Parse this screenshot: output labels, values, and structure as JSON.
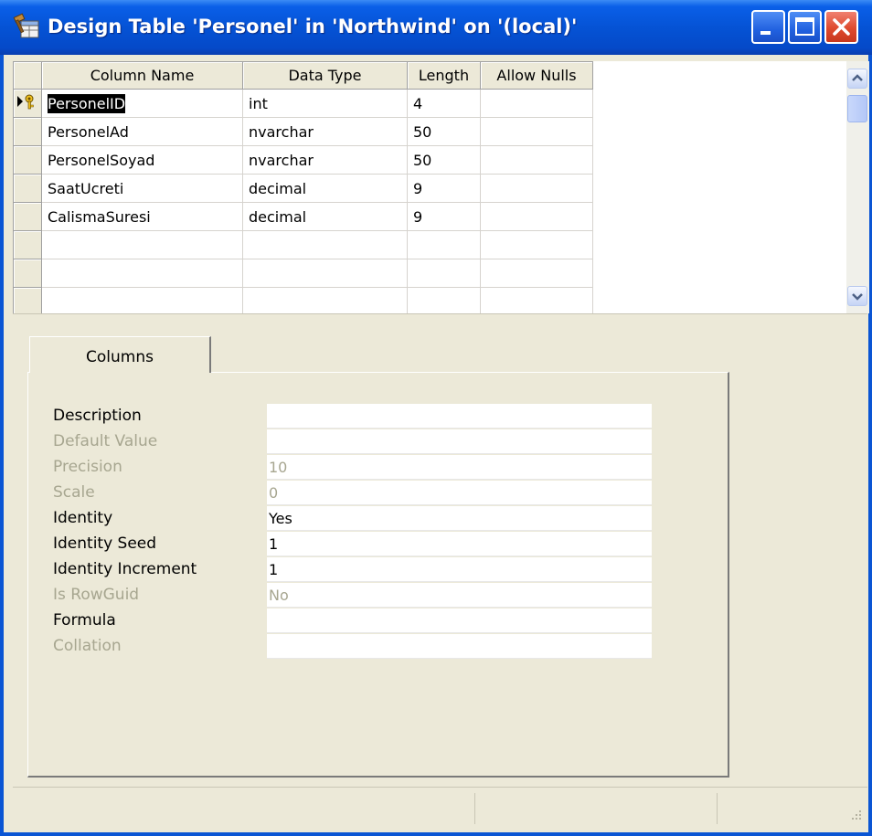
{
  "window": {
    "title": "Design Table 'Personel' in 'Northwind' on '(local)'",
    "buttons": [
      "minimize-icon",
      "maximize-icon",
      "close-icon"
    ]
  },
  "grid": {
    "headers": [
      "Column Name",
      "Data Type",
      "Length",
      "Allow Nulls"
    ],
    "rows": [
      {
        "name": "PersonelID",
        "type": "int",
        "length": "4",
        "nulls": "",
        "primary_key": true,
        "selected": true
      },
      {
        "name": "PersonelAd",
        "type": "nvarchar",
        "length": "50",
        "nulls": ""
      },
      {
        "name": "PersonelSoyad",
        "type": "nvarchar",
        "length": "50",
        "nulls": ""
      },
      {
        "name": "SaatUcreti",
        "type": "decimal",
        "length": "9",
        "nulls": ""
      },
      {
        "name": "CalismaSuresi",
        "type": "decimal",
        "length": "9",
        "nulls": ""
      },
      {
        "name": "",
        "type": "",
        "length": "",
        "nulls": ""
      },
      {
        "name": "",
        "type": "",
        "length": "",
        "nulls": ""
      },
      {
        "name": "",
        "type": "",
        "length": "",
        "nulls": ""
      }
    ]
  },
  "tabs": {
    "active": "Columns"
  },
  "properties": [
    {
      "label": "Description",
      "value": "",
      "enabled": true
    },
    {
      "label": "Default Value",
      "value": "",
      "enabled": false
    },
    {
      "label": "Precision",
      "value": "10",
      "enabled": false
    },
    {
      "label": "Scale",
      "value": "0",
      "enabled": false
    },
    {
      "label": "Identity",
      "value": "Yes",
      "enabled": true
    },
    {
      "label": "Identity Seed",
      "value": "1",
      "enabled": true
    },
    {
      "label": "Identity Increment",
      "value": "1",
      "enabled": true
    },
    {
      "label": "Is RowGuid",
      "value": "No",
      "enabled": false
    },
    {
      "label": "Formula",
      "value": "",
      "enabled": true
    },
    {
      "label": "Collation",
      "value": "",
      "enabled": false
    }
  ],
  "colors": {
    "titlebar": "#0553D5",
    "face": "#ECE9D8",
    "disabled_text": "#A7A690"
  }
}
